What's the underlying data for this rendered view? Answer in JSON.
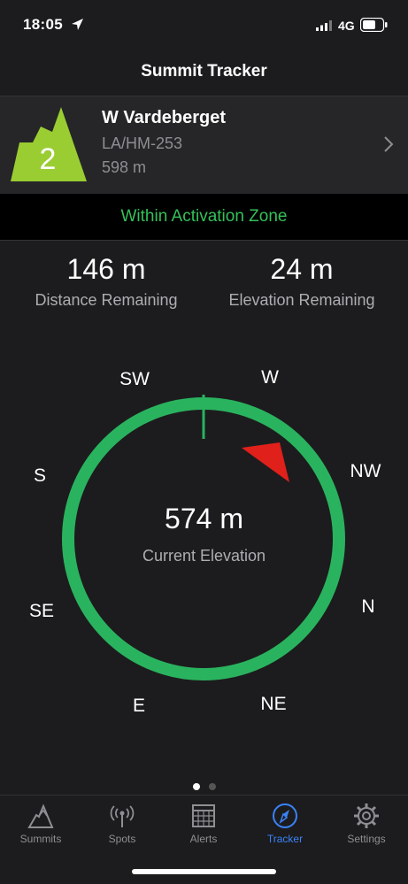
{
  "status_bar": {
    "time": "18:05",
    "network": "4G"
  },
  "nav": {
    "title": "Summit Tracker"
  },
  "summit": {
    "points": "2",
    "name": "W Vardeberget",
    "reference": "LA/HM-253",
    "altitude": "598 m"
  },
  "zone": {
    "text": "Within Activation Zone"
  },
  "stats": {
    "distance": {
      "value": "146 m",
      "label": "Distance Remaining"
    },
    "elevation": {
      "value": "24 m",
      "label": "Elevation Remaining"
    }
  },
  "compass": {
    "directions": {
      "sw": "SW",
      "w": "W",
      "nw": "NW",
      "s": "S",
      "n": "N",
      "se": "SE",
      "e": "E",
      "ne": "NE"
    },
    "current_value": "574 m",
    "current_label": "Current Elevation"
  },
  "tabs": [
    {
      "label": "Summits",
      "icon": "mountain-icon"
    },
    {
      "label": "Spots",
      "icon": "antenna-icon"
    },
    {
      "label": "Alerts",
      "icon": "calendar-icon"
    },
    {
      "label": "Tracker",
      "icon": "compass-icon",
      "active": true
    },
    {
      "label": "Settings",
      "icon": "gear-icon"
    }
  ],
  "colors": {
    "accent": "#3a82f7",
    "zone_green": "#34c05a",
    "ring_green": "#2ab35e",
    "badge_green": "#9acd32",
    "pointer_red": "#e0201a"
  }
}
